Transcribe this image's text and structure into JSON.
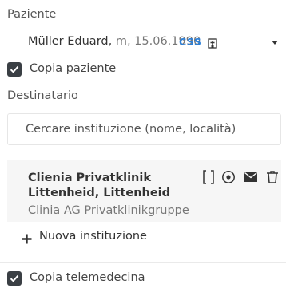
{
  "patient": {
    "label": "Paziente",
    "name": "Müller Eduard,",
    "meta": "m, 15.06.1990",
    "badge": "CSS"
  },
  "copy_patient": {
    "label": "Copia paziente",
    "checked": true
  },
  "recipient": {
    "label": "Destinatario",
    "search_placeholder": "Cercare instituzione (nome, località)"
  },
  "institution": {
    "name": "Clienia Privatklinik Littenheid, Littenheid",
    "group": "Clinia AG Privatklinikgruppe",
    "icons": [
      "document-bracket-icon",
      "eye-icon",
      "email-icon",
      "trash-icon"
    ]
  },
  "new_institution": {
    "label": "Nuova instituzione"
  },
  "copy_telemedicine": {
    "label": "Copia telemedecina",
    "checked": true
  },
  "colors": {
    "accent": "#2b7fd8",
    "checkbox": "#3a3f44",
    "card_bg": "#f6f6f6"
  }
}
